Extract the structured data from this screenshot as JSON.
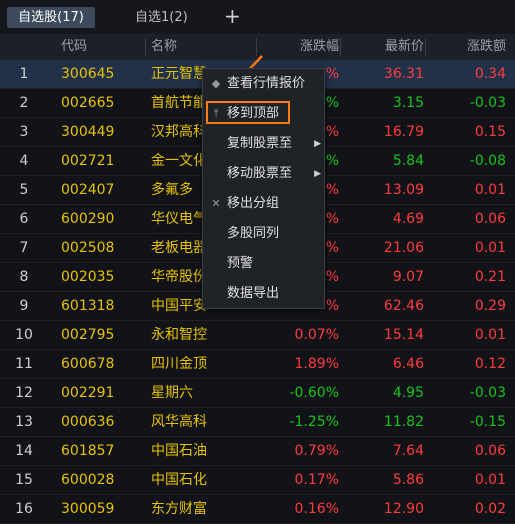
{
  "tabs": [
    {
      "label": "自选股(17)",
      "active": true
    },
    {
      "label": "自选1(2)",
      "active": false
    }
  ],
  "add_tab_icon": "plus-icon",
  "columns": {
    "code": "代码",
    "name": "名称",
    "pct": "涨跌幅",
    "price": "最新价",
    "chg": "涨跌额"
  },
  "rows": [
    {
      "no": "1",
      "code": "300645",
      "name": "正元智慧",
      "pct": "%",
      "price": "36.31",
      "chg": "0.34",
      "dir": "up"
    },
    {
      "no": "2",
      "code": "002665",
      "name": "首航节能",
      "pct": "%",
      "price": "3.15",
      "chg": "-0.03",
      "dir": "down"
    },
    {
      "no": "3",
      "code": "300449",
      "name": "汉邦高科",
      "pct": "%",
      "price": "16.79",
      "chg": "0.15",
      "dir": "up"
    },
    {
      "no": "4",
      "code": "002721",
      "name": "金一文化",
      "pct": "%",
      "price": "5.84",
      "chg": "-0.08",
      "dir": "down"
    },
    {
      "no": "5",
      "code": "002407",
      "name": "多氟多",
      "pct": "%",
      "price": "13.09",
      "chg": "0.01",
      "dir": "up"
    },
    {
      "no": "6",
      "code": "600290",
      "name": "华仪电气",
      "pct": "%",
      "price": "4.69",
      "chg": "0.06",
      "dir": "up"
    },
    {
      "no": "7",
      "code": "002508",
      "name": "老板电器",
      "pct": "%",
      "price": "21.06",
      "chg": "0.01",
      "dir": "up"
    },
    {
      "no": "8",
      "code": "002035",
      "name": "华帝股份",
      "pct": "%",
      "price": "9.07",
      "chg": "0.21",
      "dir": "up"
    },
    {
      "no": "9",
      "code": "601318",
      "name": "中国平安",
      "pct": "%",
      "price": "62.46",
      "chg": "0.29",
      "dir": "up"
    },
    {
      "no": "10",
      "code": "002795",
      "name": "永和智控",
      "pct": "0.07%",
      "price": "15.14",
      "chg": "0.01",
      "dir": "up"
    },
    {
      "no": "11",
      "code": "600678",
      "name": "四川金顶",
      "pct": "1.89%",
      "price": "6.46",
      "chg": "0.12",
      "dir": "up"
    },
    {
      "no": "12",
      "code": "002291",
      "name": "星期六",
      "pct": "-0.60%",
      "price": "4.95",
      "chg": "-0.03",
      "dir": "down"
    },
    {
      "no": "13",
      "code": "000636",
      "name": "风华高科",
      "pct": "-1.25%",
      "price": "11.82",
      "chg": "-0.15",
      "dir": "down"
    },
    {
      "no": "14",
      "code": "601857",
      "name": "中国石油",
      "pct": "0.79%",
      "price": "7.64",
      "chg": "0.06",
      "dir": "up"
    },
    {
      "no": "15",
      "code": "600028",
      "name": "中国石化",
      "pct": "0.17%",
      "price": "5.86",
      "chg": "0.01",
      "dir": "up"
    },
    {
      "no": "16",
      "code": "300059",
      "name": "东方财富",
      "pct": "0.16%",
      "price": "12.90",
      "chg": "0.02",
      "dir": "up"
    }
  ],
  "context_menu": [
    {
      "label": "查看行情报价",
      "icon": "tag-icon",
      "submenu": false
    },
    {
      "label": "移到顶部",
      "icon": "move-to-top-icon",
      "submenu": false,
      "highlighted": true
    },
    {
      "label": "复制股票至",
      "icon": "",
      "submenu": true
    },
    {
      "label": "移动股票至",
      "icon": "",
      "submenu": true
    },
    {
      "label": "移出分组",
      "icon": "close-icon",
      "submenu": false
    },
    {
      "label": "多股同列",
      "icon": "",
      "submenu": false
    },
    {
      "label": "预警",
      "icon": "",
      "submenu": false
    },
    {
      "label": "数据导出",
      "icon": "",
      "submenu": false
    }
  ],
  "colors": {
    "up": "#ff3b3b",
    "down": "#19c519",
    "stock": "#e6c200",
    "accent": "#ff7a14"
  }
}
